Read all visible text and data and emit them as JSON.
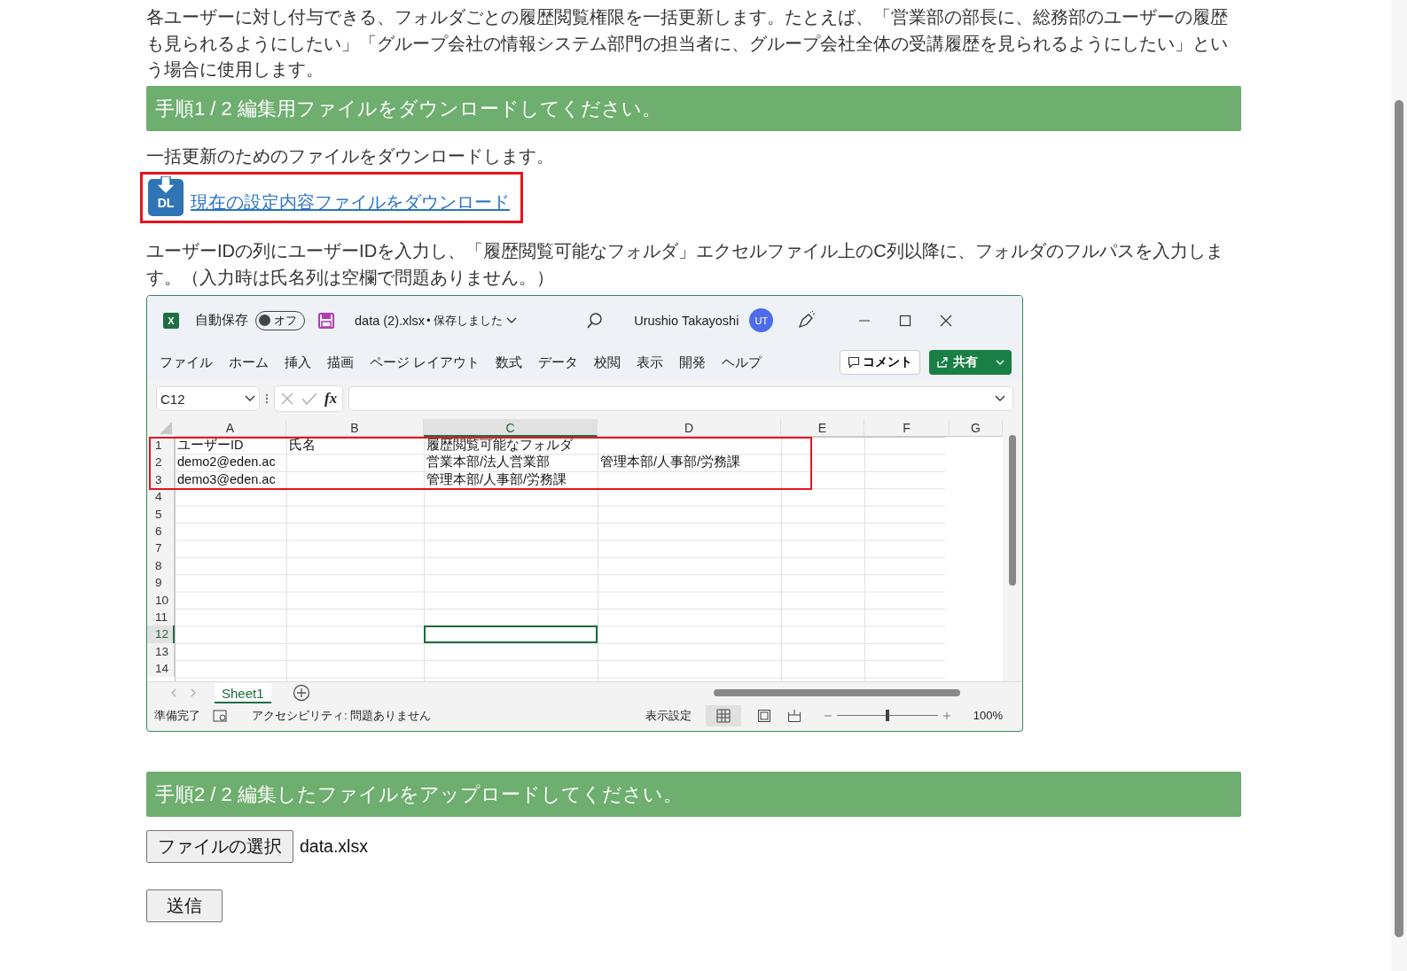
{
  "intro": "各ユーザーに対し付与できる、フォルダごとの履歴閲覧権限を一括更新します。たとえば、「営業部の部長に、総務部のユーザーの履歴も見られるようにしたい」「グループ会社の情報システム部門の担当者に、グループ会社全体の受講履歴を見られるようにしたい」という場合に使用します。",
  "step1": {
    "heading": "手順1 / 2 編集用ファイルをダウンロードしてください。",
    "lead": "一括更新のためのファイルをダウンロードします。",
    "download_icon_text": "DL",
    "download_link": "現在の設定内容ファイルをダウンロード",
    "instruction": "ユーザーIDの列にユーザーIDを入力し、「履歴閲覧可能なフォルダ」エクセルファイル上のC列以降に、フォルダのフルパスを入力します。（入力時は氏名列は空欄で問題ありません。）"
  },
  "excel": {
    "app_icon_text": "X",
    "autosave_label": "自動保存",
    "autosave_toggle": {
      "label": "オフ",
      "on": false
    },
    "filename": "data (2).xlsx",
    "save_status": "• 保存しました",
    "user_name": "Urushio Takayoshi",
    "avatar_initials": "UT",
    "ribbon_tabs": [
      "ファイル",
      "ホーム",
      "挿入",
      "描画",
      "ページ レイアウト",
      "数式",
      "データ",
      "校閲",
      "表示",
      "開発",
      "ヘルプ"
    ],
    "comment_button": "コメント",
    "share_button": "共有",
    "name_box": "C12",
    "fx": "fx",
    "columns": [
      {
        "label": "A",
        "selected": false
      },
      {
        "label": "B",
        "selected": false
      },
      {
        "label": "C",
        "selected": true
      },
      {
        "label": "D",
        "selected": false
      },
      {
        "label": "E",
        "selected": false
      },
      {
        "label": "F",
        "selected": false
      },
      {
        "label": "G",
        "selected": false
      }
    ],
    "rows": [
      {
        "number": "1",
        "selected": false,
        "cells": {
          "A": "ユーザーID",
          "B": "氏名",
          "C": "履歴閲覧可能なフォルダ"
        }
      },
      {
        "number": "2",
        "selected": false,
        "cells": {
          "A": "demo2@eden.ac",
          "C": "営業本部/法人営業部",
          "D": "管理本部/人事部/労務課"
        }
      },
      {
        "number": "3",
        "selected": false,
        "cells": {
          "A": "demo3@eden.ac",
          "C": "管理本部/人事部/労務課"
        }
      },
      {
        "number": "4",
        "selected": false
      },
      {
        "number": "5",
        "selected": false
      },
      {
        "number": "6",
        "selected": false
      },
      {
        "number": "7",
        "selected": false
      },
      {
        "number": "8",
        "selected": false
      },
      {
        "number": "9",
        "selected": false
      },
      {
        "number": "10",
        "selected": false
      },
      {
        "number": "11",
        "selected": false
      },
      {
        "number": "12",
        "selected": true
      },
      {
        "number": "13",
        "selected": false
      },
      {
        "number": "14",
        "selected": false
      }
    ],
    "sheet_tabs": [
      {
        "label": "Sheet1",
        "selected": true
      }
    ],
    "status": "準備完了",
    "accessibility": "アクセシビリティ: 問題ありません",
    "display_settings": "表示設定",
    "zoom": "100%",
    "zoom_slider": {
      "level": 0.5
    }
  },
  "step2": {
    "heading": "手順2 / 2 編集したファイルをアップロードしてください。",
    "file_button": "ファイルの選択",
    "file_name": "data.xlsx",
    "submit": "送信"
  }
}
